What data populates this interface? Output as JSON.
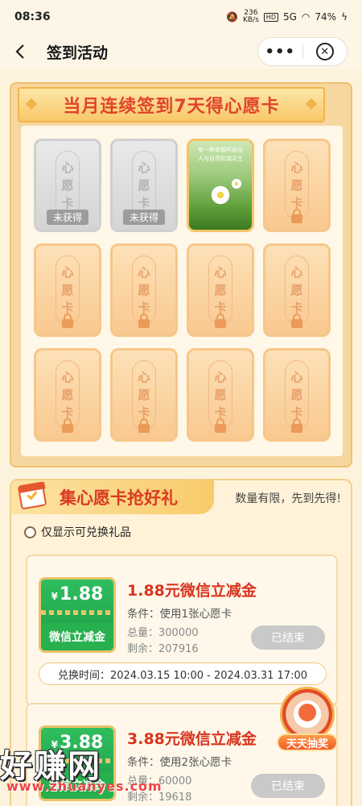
{
  "status_bar": {
    "time": "08:36",
    "net_speed_value": "236",
    "net_speed_unit": "KB/s",
    "hd": "HD",
    "signal": "5G",
    "battery": "74%"
  },
  "nav": {
    "title": "签到活动",
    "more_label": "•••"
  },
  "signin_panel": {
    "banner": "当月连续签到7天得心愿卡",
    "cards": [
      {
        "state": "grey",
        "chars": [
          "心",
          "愿",
          "卡"
        ],
        "tag": "未获得"
      },
      {
        "state": "grey",
        "chars": [
          "心",
          "愿",
          "卡"
        ],
        "tag": "未获得"
      },
      {
        "state": "photo",
        "photo_text": "有一种幸福叫自在\n人与自然和谐共生"
      },
      {
        "state": "locked",
        "chars": [
          "心",
          "愿",
          "卡"
        ]
      },
      {
        "state": "locked",
        "chars": [
          "心",
          "愿",
          "卡"
        ]
      },
      {
        "state": "locked",
        "chars": [
          "心",
          "愿",
          "卡"
        ]
      },
      {
        "state": "locked",
        "chars": [
          "心",
          "愿",
          "卡"
        ]
      },
      {
        "state": "locked",
        "chars": [
          "心",
          "愿",
          "卡"
        ]
      },
      {
        "state": "locked",
        "chars": [
          "心",
          "愿",
          "卡"
        ]
      },
      {
        "state": "locked",
        "chars": [
          "心",
          "愿",
          "卡"
        ]
      },
      {
        "state": "locked",
        "chars": [
          "心",
          "愿",
          "卡"
        ]
      },
      {
        "state": "locked",
        "chars": [
          "心",
          "愿",
          "卡"
        ]
      }
    ]
  },
  "gifts_section": {
    "title": "集心愿卡抢好礼",
    "note": "数量有限，先到先得!",
    "filter_label": "仅显示可兑换礼品",
    "gifts": [
      {
        "chip_currency": "¥",
        "chip_amount": "1.88",
        "chip_label": "微信立减金",
        "name": "1.88元微信立减金",
        "condition": "条件：使用1张心愿卡",
        "total_label": "总量：",
        "total": "300000",
        "remain_label": "剩余：",
        "remain": "207916",
        "button": "已结束",
        "time": "兑换时间：2024.03.15 10:00 - 2024.03.31 17:00"
      },
      {
        "chip_currency": "¥",
        "chip_amount": "3.88",
        "chip_label": "微信立减金",
        "name": "3.88元微信立减金",
        "condition": "条件：使用2张心愿卡",
        "total_label": "总量：",
        "total": "60000",
        "remain_label": "剩余：",
        "remain": "19618",
        "button": "已结束"
      }
    ]
  },
  "lottery": {
    "label": "天天抽奖"
  },
  "watermark": {
    "text": "好赚网",
    "url": "www.zhuanyes.com"
  },
  "colors": {
    "accent_red": "#d9331e",
    "panel_orange": "#f6d7a0",
    "wechat_green": "#1c9a45"
  }
}
